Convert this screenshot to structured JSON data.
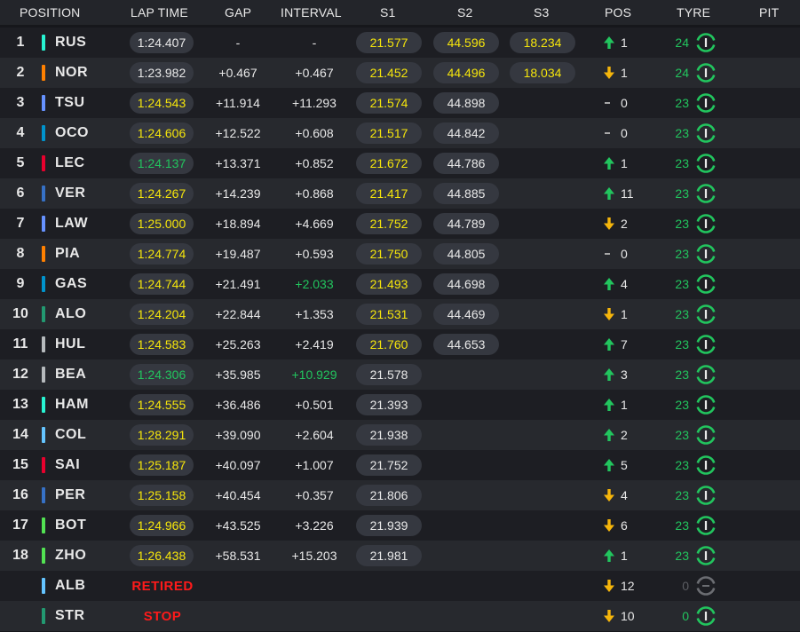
{
  "header": {
    "position": "POSITION",
    "lap_time": "LAP TIME",
    "gap": "GAP",
    "interval": "INTERVAL",
    "s1": "S1",
    "s2": "S2",
    "s3": "S3",
    "pos": "POS",
    "tyre": "TYRE",
    "pit": "PIT"
  },
  "colors": {
    "mercedes": "#27f4d2",
    "mclaren": "#ff8000",
    "racing_bulls": "#6692ff",
    "alpine": "#0093cc",
    "ferrari": "#e8002d",
    "red_bull": "#3671c6",
    "haas": "#b6babd",
    "williams": "#64c4ff",
    "sauber": "#52e252",
    "aston_martin": "#229971",
    "best": "#22c55e",
    "personal_best": "#f5e50b",
    "retired": "#ff1a1a",
    "gained": "#22c55e",
    "lost": "#f5b50b"
  },
  "drivers": [
    {
      "pos": "1",
      "code": "RUS",
      "team_color": "#27f4d2",
      "lap": "1:24.407",
      "lap_color": "white",
      "gap": "-",
      "interval": "-",
      "interval_color": "white",
      "s1": "21.577",
      "s1_color": "yellow",
      "s2": "44.596",
      "s2_color": "yellow",
      "s3": "18.234",
      "s3_color": "yellow",
      "dir": "up",
      "change": "1",
      "tyre_laps": "24",
      "tyre_active": true
    },
    {
      "pos": "2",
      "code": "NOR",
      "team_color": "#ff8000",
      "lap": "1:23.982",
      "lap_color": "white",
      "gap": "+0.467",
      "interval": "+0.467",
      "interval_color": "white",
      "s1": "21.452",
      "s1_color": "yellow",
      "s2": "44.496",
      "s2_color": "yellow",
      "s3": "18.034",
      "s3_color": "yellow",
      "dir": "down",
      "change": "1",
      "tyre_laps": "24",
      "tyre_active": true
    },
    {
      "pos": "3",
      "code": "TSU",
      "team_color": "#6692ff",
      "lap": "1:24.543",
      "lap_color": "yellow",
      "gap": "+11.914",
      "interval": "+11.293",
      "interval_color": "white",
      "s1": "21.574",
      "s1_color": "yellow",
      "s2": "44.898",
      "s2_color": "white",
      "s3": "",
      "s3_color": "white",
      "dir": "none",
      "change": "0",
      "tyre_laps": "23",
      "tyre_active": true
    },
    {
      "pos": "4",
      "code": "OCO",
      "team_color": "#0093cc",
      "lap": "1:24.606",
      "lap_color": "yellow",
      "gap": "+12.522",
      "interval": "+0.608",
      "interval_color": "white",
      "s1": "21.517",
      "s1_color": "yellow",
      "s2": "44.842",
      "s2_color": "white",
      "s3": "",
      "s3_color": "white",
      "dir": "none",
      "change": "0",
      "tyre_laps": "23",
      "tyre_active": true
    },
    {
      "pos": "5",
      "code": "LEC",
      "team_color": "#e8002d",
      "lap": "1:24.137",
      "lap_color": "green",
      "gap": "+13.371",
      "interval": "+0.852",
      "interval_color": "white",
      "s1": "21.672",
      "s1_color": "yellow",
      "s2": "44.786",
      "s2_color": "white",
      "s3": "",
      "s3_color": "white",
      "dir": "up",
      "change": "1",
      "tyre_laps": "23",
      "tyre_active": true
    },
    {
      "pos": "6",
      "code": "VER",
      "team_color": "#3671c6",
      "lap": "1:24.267",
      "lap_color": "yellow",
      "gap": "+14.239",
      "interval": "+0.868",
      "interval_color": "white",
      "s1": "21.417",
      "s1_color": "yellow",
      "s2": "44.885",
      "s2_color": "white",
      "s3": "",
      "s3_color": "white",
      "dir": "up",
      "change": "11",
      "tyre_laps": "23",
      "tyre_active": true
    },
    {
      "pos": "7",
      "code": "LAW",
      "team_color": "#6692ff",
      "lap": "1:25.000",
      "lap_color": "yellow",
      "gap": "+18.894",
      "interval": "+4.669",
      "interval_color": "white",
      "s1": "21.752",
      "s1_color": "yellow",
      "s2": "44.789",
      "s2_color": "white",
      "s3": "",
      "s3_color": "white",
      "dir": "down",
      "change": "2",
      "tyre_laps": "23",
      "tyre_active": true
    },
    {
      "pos": "8",
      "code": "PIA",
      "team_color": "#ff8000",
      "lap": "1:24.774",
      "lap_color": "yellow",
      "gap": "+19.487",
      "interval": "+0.593",
      "interval_color": "white",
      "s1": "21.750",
      "s1_color": "yellow",
      "s2": "44.805",
      "s2_color": "white",
      "s3": "",
      "s3_color": "white",
      "dir": "none",
      "change": "0",
      "tyre_laps": "23",
      "tyre_active": true
    },
    {
      "pos": "9",
      "code": "GAS",
      "team_color": "#0093cc",
      "lap": "1:24.744",
      "lap_color": "yellow",
      "gap": "+21.491",
      "interval": "+2.033",
      "interval_color": "green",
      "s1": "21.493",
      "s1_color": "yellow",
      "s2": "44.698",
      "s2_color": "white",
      "s3": "",
      "s3_color": "white",
      "dir": "up",
      "change": "4",
      "tyre_laps": "23",
      "tyre_active": true
    },
    {
      "pos": "10",
      "code": "ALO",
      "team_color": "#229971",
      "lap": "1:24.204",
      "lap_color": "yellow",
      "gap": "+22.844",
      "interval": "+1.353",
      "interval_color": "white",
      "s1": "21.531",
      "s1_color": "yellow",
      "s2": "44.469",
      "s2_color": "white",
      "s3": "",
      "s3_color": "white",
      "dir": "down",
      "change": "1",
      "tyre_laps": "23",
      "tyre_active": true
    },
    {
      "pos": "11",
      "code": "HUL",
      "team_color": "#b6babd",
      "lap": "1:24.583",
      "lap_color": "yellow",
      "gap": "+25.263",
      "interval": "+2.419",
      "interval_color": "white",
      "s1": "21.760",
      "s1_color": "yellow",
      "s2": "44.653",
      "s2_color": "white",
      "s3": "",
      "s3_color": "white",
      "dir": "up",
      "change": "7",
      "tyre_laps": "23",
      "tyre_active": true
    },
    {
      "pos": "12",
      "code": "BEA",
      "team_color": "#b6babd",
      "lap": "1:24.306",
      "lap_color": "green",
      "gap": "+35.985",
      "interval": "+10.929",
      "interval_color": "green",
      "s1": "21.578",
      "s1_color": "white",
      "s2": "",
      "s2_color": "white",
      "s3": "",
      "s3_color": "white",
      "dir": "up",
      "change": "3",
      "tyre_laps": "23",
      "tyre_active": true
    },
    {
      "pos": "13",
      "code": "HAM",
      "team_color": "#27f4d2",
      "lap": "1:24.555",
      "lap_color": "yellow",
      "gap": "+36.486",
      "interval": "+0.501",
      "interval_color": "white",
      "s1": "21.393",
      "s1_color": "white",
      "s2": "",
      "s2_color": "white",
      "s3": "",
      "s3_color": "white",
      "dir": "up",
      "change": "1",
      "tyre_laps": "23",
      "tyre_active": true
    },
    {
      "pos": "14",
      "code": "COL",
      "team_color": "#64c4ff",
      "lap": "1:28.291",
      "lap_color": "yellow",
      "gap": "+39.090",
      "interval": "+2.604",
      "interval_color": "white",
      "s1": "21.938",
      "s1_color": "white",
      "s2": "",
      "s2_color": "white",
      "s3": "",
      "s3_color": "white",
      "dir": "up",
      "change": "2",
      "tyre_laps": "23",
      "tyre_active": true
    },
    {
      "pos": "15",
      "code": "SAI",
      "team_color": "#e8002d",
      "lap": "1:25.187",
      "lap_color": "yellow",
      "gap": "+40.097",
      "interval": "+1.007",
      "interval_color": "white",
      "s1": "21.752",
      "s1_color": "white",
      "s2": "",
      "s2_color": "white",
      "s3": "",
      "s3_color": "white",
      "dir": "up",
      "change": "5",
      "tyre_laps": "23",
      "tyre_active": true
    },
    {
      "pos": "16",
      "code": "PER",
      "team_color": "#3671c6",
      "lap": "1:25.158",
      "lap_color": "yellow",
      "gap": "+40.454",
      "interval": "+0.357",
      "interval_color": "white",
      "s1": "21.806",
      "s1_color": "white",
      "s2": "",
      "s2_color": "white",
      "s3": "",
      "s3_color": "white",
      "dir": "down",
      "change": "4",
      "tyre_laps": "23",
      "tyre_active": true
    },
    {
      "pos": "17",
      "code": "BOT",
      "team_color": "#52e252",
      "lap": "1:24.966",
      "lap_color": "yellow",
      "gap": "+43.525",
      "interval": "+3.226",
      "interval_color": "white",
      "s1": "21.939",
      "s1_color": "white",
      "s2": "",
      "s2_color": "white",
      "s3": "",
      "s3_color": "white",
      "dir": "down",
      "change": "6",
      "tyre_laps": "23",
      "tyre_active": true
    },
    {
      "pos": "18",
      "code": "ZHO",
      "team_color": "#52e252",
      "lap": "1:26.438",
      "lap_color": "yellow",
      "gap": "+58.531",
      "interval": "+15.203",
      "interval_color": "white",
      "s1": "21.981",
      "s1_color": "white",
      "s2": "",
      "s2_color": "white",
      "s3": "",
      "s3_color": "white",
      "dir": "up",
      "change": "1",
      "tyre_laps": "23",
      "tyre_active": true
    },
    {
      "pos": "",
      "code": "ALB",
      "team_color": "#64c4ff",
      "status": "RETIRED",
      "dir": "down",
      "change": "12",
      "tyre_laps": "0",
      "tyre_active": false
    },
    {
      "pos": "",
      "code": "STR",
      "team_color": "#229971",
      "status": "STOP",
      "dir": "down",
      "change": "10",
      "tyre_laps": "0",
      "tyre_active": true
    }
  ]
}
